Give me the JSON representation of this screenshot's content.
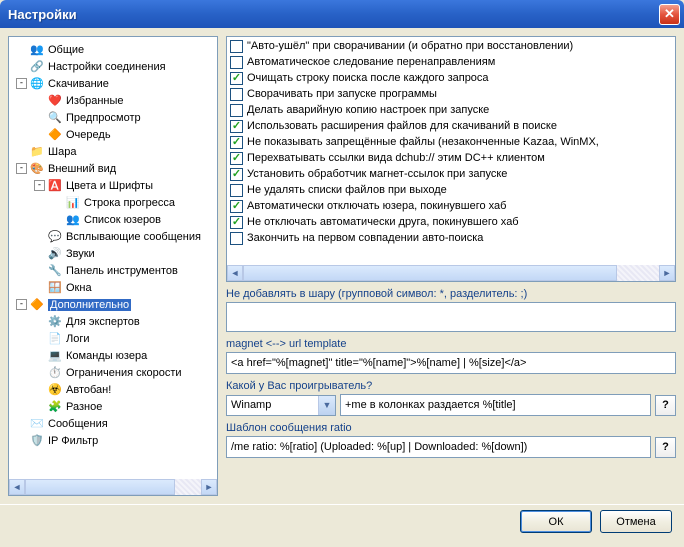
{
  "window": {
    "title": "Настройки"
  },
  "tree": [
    {
      "depth": 0,
      "toggle": "",
      "icon": "👥",
      "label": "Общие"
    },
    {
      "depth": 0,
      "toggle": "",
      "icon": "🔗",
      "label": "Настройки соединения"
    },
    {
      "depth": 0,
      "toggle": "-",
      "icon": "🌐",
      "label": "Скачивание"
    },
    {
      "depth": 1,
      "toggle": "",
      "icon": "❤️",
      "label": "Избранные"
    },
    {
      "depth": 1,
      "toggle": "",
      "icon": "🔍",
      "label": "Предпросмотр"
    },
    {
      "depth": 1,
      "toggle": "",
      "icon": "🔶",
      "label": "Очередь"
    },
    {
      "depth": 0,
      "toggle": "",
      "icon": "📁",
      "label": "Шара"
    },
    {
      "depth": 0,
      "toggle": "-",
      "icon": "🎨",
      "label": "Внешний вид"
    },
    {
      "depth": 1,
      "toggle": "-",
      "icon": "🅰️",
      "label": "Цвета и Шрифты"
    },
    {
      "depth": 2,
      "toggle": "",
      "icon": "📊",
      "label": "Строка прогресса"
    },
    {
      "depth": 2,
      "toggle": "",
      "icon": "👥",
      "label": "Список юзеров"
    },
    {
      "depth": 1,
      "toggle": "",
      "icon": "💬",
      "label": "Всплывающие сообщения"
    },
    {
      "depth": 1,
      "toggle": "",
      "icon": "🔊",
      "label": "Звуки"
    },
    {
      "depth": 1,
      "toggle": "",
      "icon": "🔧",
      "label": "Панель инструментов"
    },
    {
      "depth": 1,
      "toggle": "",
      "icon": "🪟",
      "label": "Окна"
    },
    {
      "depth": 0,
      "toggle": "-",
      "icon": "🔶",
      "label": "Дополнительно",
      "selected": true
    },
    {
      "depth": 1,
      "toggle": "",
      "icon": "⚙️",
      "label": "Для экспертов"
    },
    {
      "depth": 1,
      "toggle": "",
      "icon": "📄",
      "label": "Логи"
    },
    {
      "depth": 1,
      "toggle": "",
      "icon": "💻",
      "label": "Команды юзера"
    },
    {
      "depth": 1,
      "toggle": "",
      "icon": "⏱️",
      "label": "Ограничения скорости"
    },
    {
      "depth": 1,
      "toggle": "",
      "icon": "☣️",
      "label": "Автобан!"
    },
    {
      "depth": 1,
      "toggle": "",
      "icon": "🧩",
      "label": "Разное"
    },
    {
      "depth": 0,
      "toggle": "",
      "icon": "✉️",
      "label": "Сообщения"
    },
    {
      "depth": 0,
      "toggle": "",
      "icon": "🛡️",
      "label": "IP Фильтр"
    }
  ],
  "checks": [
    {
      "checked": false,
      "label": "\"Авто-ушёл\" при сворачивании (и обратно при восстановлении)"
    },
    {
      "checked": false,
      "label": "Автоматическое следование перенаправлениям"
    },
    {
      "checked": true,
      "label": "Очищать строку поиска после каждого запроса"
    },
    {
      "checked": false,
      "label": "Сворачивать при запуске программы"
    },
    {
      "checked": false,
      "label": "Делать аварийную копию настроек при запуске"
    },
    {
      "checked": true,
      "label": "Использовать расширения файлов для скачиваний в поиске"
    },
    {
      "checked": true,
      "label": "Не показывать запрещённые файлы (незаконченные Kazaa, WinMX,"
    },
    {
      "checked": true,
      "label": "Перехватывать ссылки вида dchub:// этим DC++ клиентом"
    },
    {
      "checked": true,
      "label": "Установить обработчик магнет-ссылок при запуске"
    },
    {
      "checked": false,
      "label": "Не удалять списки файлов при выходе"
    },
    {
      "checked": true,
      "label": "Автоматически отключать юзера, покинувшего хаб"
    },
    {
      "checked": true,
      "label": "Не отключать автоматически друга, покинувшего хаб"
    },
    {
      "checked": false,
      "label": "Закончить на первом совпадении авто-поиска"
    }
  ],
  "groups": {
    "share_label": "Не добавлять в шару (групповой символ: *, разделитель: ;)",
    "magnet_label": "magnet  <--> url template",
    "magnet_value": "<a href=\"%[magnet]\" title=\"%[name]\">%[name] | %[size]</a>",
    "player_label": "Какой у Вас проигрыватель?",
    "player_value": "Winamp",
    "player_cmd": "+me в колонках раздается %[title]",
    "ratio_label": "Шаблон сообщения ratio",
    "ratio_value": "/me ratio: %[ratio] (Uploaded: %[up] | Downloaded: %[down])"
  },
  "buttons": {
    "ok": "ОК",
    "cancel": "Отмена",
    "help": "?"
  }
}
